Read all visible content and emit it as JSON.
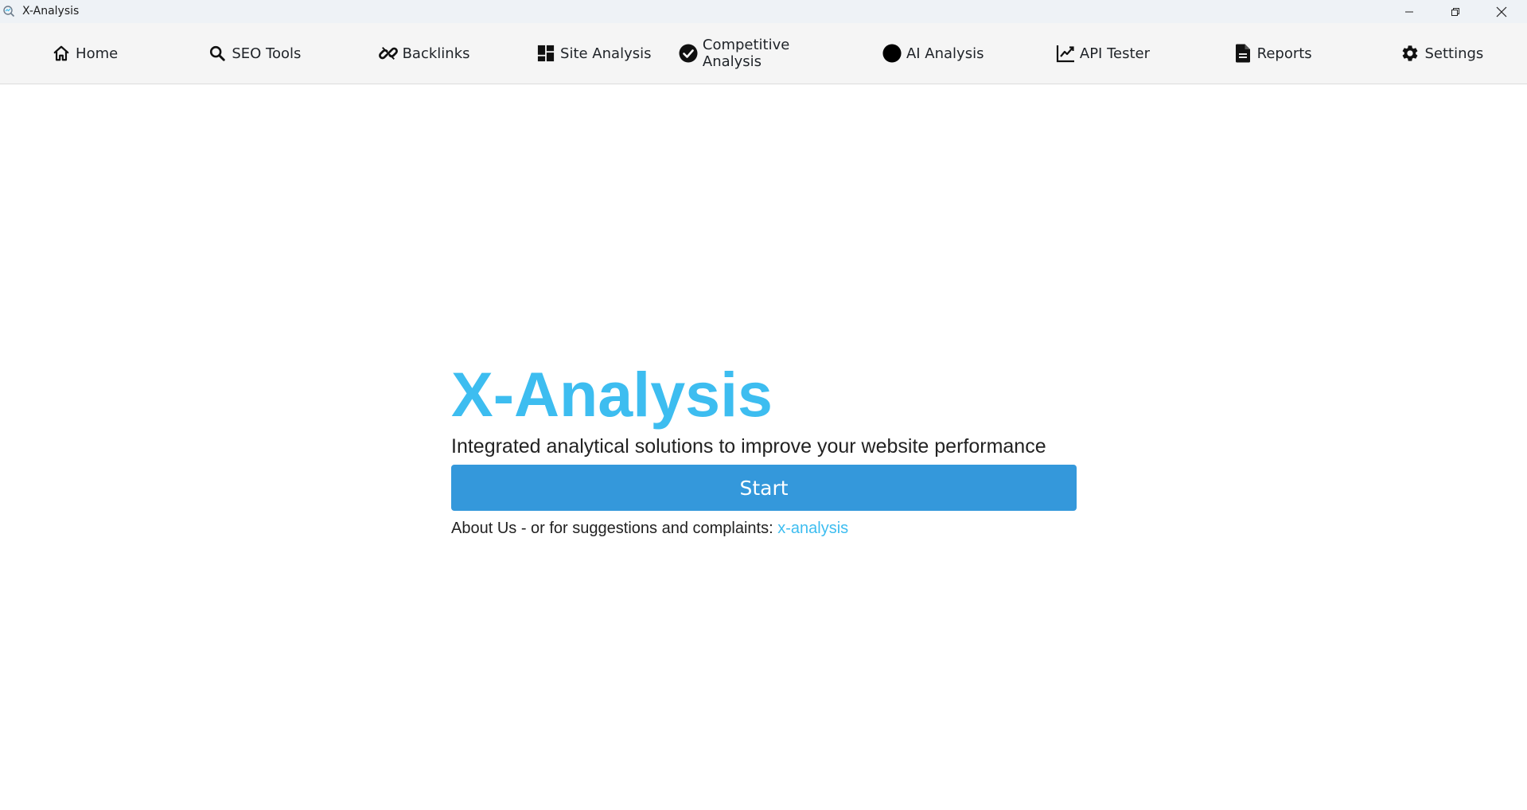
{
  "window": {
    "title": "X-Analysis"
  },
  "colors": {
    "accent": "#3dbdf0",
    "button": "#3498db",
    "link": "#3dbdf0"
  },
  "nav": {
    "items": [
      {
        "label": "Home",
        "icon": "home-icon"
      },
      {
        "label": "SEO Tools",
        "icon": "search-icon"
      },
      {
        "label": "Backlinks",
        "icon": "link-icon"
      },
      {
        "label": "Site Analysis",
        "icon": "grid-icon"
      },
      {
        "label": "Competitive Analysis",
        "icon": "check-circle-icon"
      },
      {
        "label": "AI Analysis",
        "icon": "circle-icon"
      },
      {
        "label": "API Tester",
        "icon": "chart-icon"
      },
      {
        "label": "Reports",
        "icon": "document-icon"
      },
      {
        "label": "Settings",
        "icon": "gear-icon"
      }
    ]
  },
  "hero": {
    "title": "X-Analysis",
    "subtitle": "Integrated analytical solutions to improve your website performance",
    "start_label": "Start",
    "footer_text": "About Us - or for suggestions and complaints: ",
    "footer_link": "x-analysis"
  }
}
